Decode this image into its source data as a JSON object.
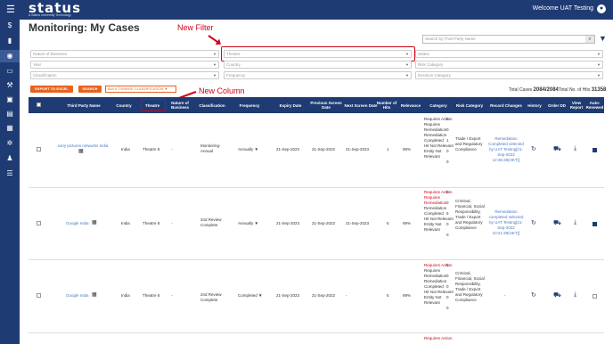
{
  "app": {
    "logo": "status",
    "logo_sub": "A Status University Technology",
    "welcome": "Welcome UAT Testing"
  },
  "page": {
    "title": "Monitoring: My Cases"
  },
  "annotations": {
    "new_filter": "New Filter",
    "new_column": "New Column"
  },
  "search": {
    "placeholder": "Search by Third Party Name"
  },
  "filters": {
    "row1": [
      "Nature of Business",
      "Theatre",
      "Status"
    ],
    "row2": [
      "Year",
      "Country",
      "Risk Category"
    ],
    "row3": [
      "Classification",
      "Frequency",
      "Decision Category"
    ]
  },
  "buttons": {
    "export": "EXPORT TO EXCEL",
    "search": "SEARCH",
    "bulk": "BULK CHANGE CLASSIFICATION"
  },
  "totals": {
    "cases_label": "Total Cases",
    "cases": "2084/2084",
    "hits_label": "Total No. of Hits",
    "hits": "31358"
  },
  "columns": [
    "Third Party Name",
    "Country",
    "Theatre",
    "Nature of Business",
    "Classification",
    "Frequency",
    "Expiry Date",
    "Previous Screen Date",
    "Next Screen Date",
    "Number of Hits",
    "Relevance",
    "Category",
    "Risk Category",
    "Record Changes",
    "History",
    "Order DD",
    "View Report",
    "Auto-Renewed"
  ],
  "rows": [
    {
      "name": "sony pictures networks India",
      "country": "India",
      "theatre": "Theatre 8",
      "nob": "-",
      "classification": "Monitoring-Annual",
      "frequency": "Annually",
      "expiry": "21-Sep-2023",
      "prev": "21-Sep-2022",
      "next": "21-Sep-2023",
      "hits": "1",
      "relevance": "98%",
      "category": [
        [
          "Requires Action",
          "0",
          false
        ],
        [
          "Requires Remediation",
          "0",
          false
        ],
        [
          "Remediation Completed",
          "1",
          false
        ],
        [
          "Hit Not Relevant",
          "0",
          false
        ],
        [
          "Entity Not Relevant",
          "0",
          false
        ]
      ],
      "risk": "Trade / Export and Regulatory Compliance",
      "record": "Remediation Completed selected by UAT Testing[21-Sep-2022 12:36:28(HKT)]",
      "auto": true
    },
    {
      "name": "Google India",
      "country": "India",
      "theatre": "Theatre 8",
      "nob": "-",
      "classification": "2nd Review Complete",
      "frequency": "Annually",
      "expiry": "21-Sep-2023",
      "prev": "21-Sep-2022",
      "next": "21-Sep-2023",
      "hits": "5",
      "relevance": "99%",
      "category": [
        [
          "Requires Action",
          "0",
          true
        ],
        [
          "Requires Remediation",
          "0",
          true
        ],
        [
          "Remediation Completed",
          "5",
          false
        ],
        [
          "Hit Not Relevant",
          "0",
          false
        ],
        [
          "Entity Not Relevant",
          "0",
          false
        ]
      ],
      "risk": "Criminal, Financial, Social Responsibility, Trade / Export and Regulatory Compliance",
      "record": "Remediation completed selected by UAT Testing[21-Sep-2022 10:21:39(HKT)]",
      "auto": true
    },
    {
      "name": "Google India",
      "country": "India",
      "theatre": "Theatre 8",
      "nob": "-",
      "classification": "2nd Review Complete",
      "frequency": "Completed",
      "expiry": "21-Sep-2023",
      "prev": "21-Sep-2022",
      "next": "-",
      "hits": "5",
      "relevance": "99%",
      "category": [
        [
          "Requires Action",
          "5",
          true
        ],
        [
          "Requires Remediation",
          "0",
          false
        ],
        [
          "Remediation Completed",
          "0",
          false
        ],
        [
          "Hit Not Relevant",
          "0",
          false
        ],
        [
          "Entity Not Relevant",
          "0",
          false
        ]
      ],
      "risk": "Criminal, Financial, Social Responsibility, Trade / Export and Regulatory Compliance",
      "record": "-",
      "auto": false
    }
  ],
  "partial_row": {
    "category_first": "Requires Action"
  }
}
